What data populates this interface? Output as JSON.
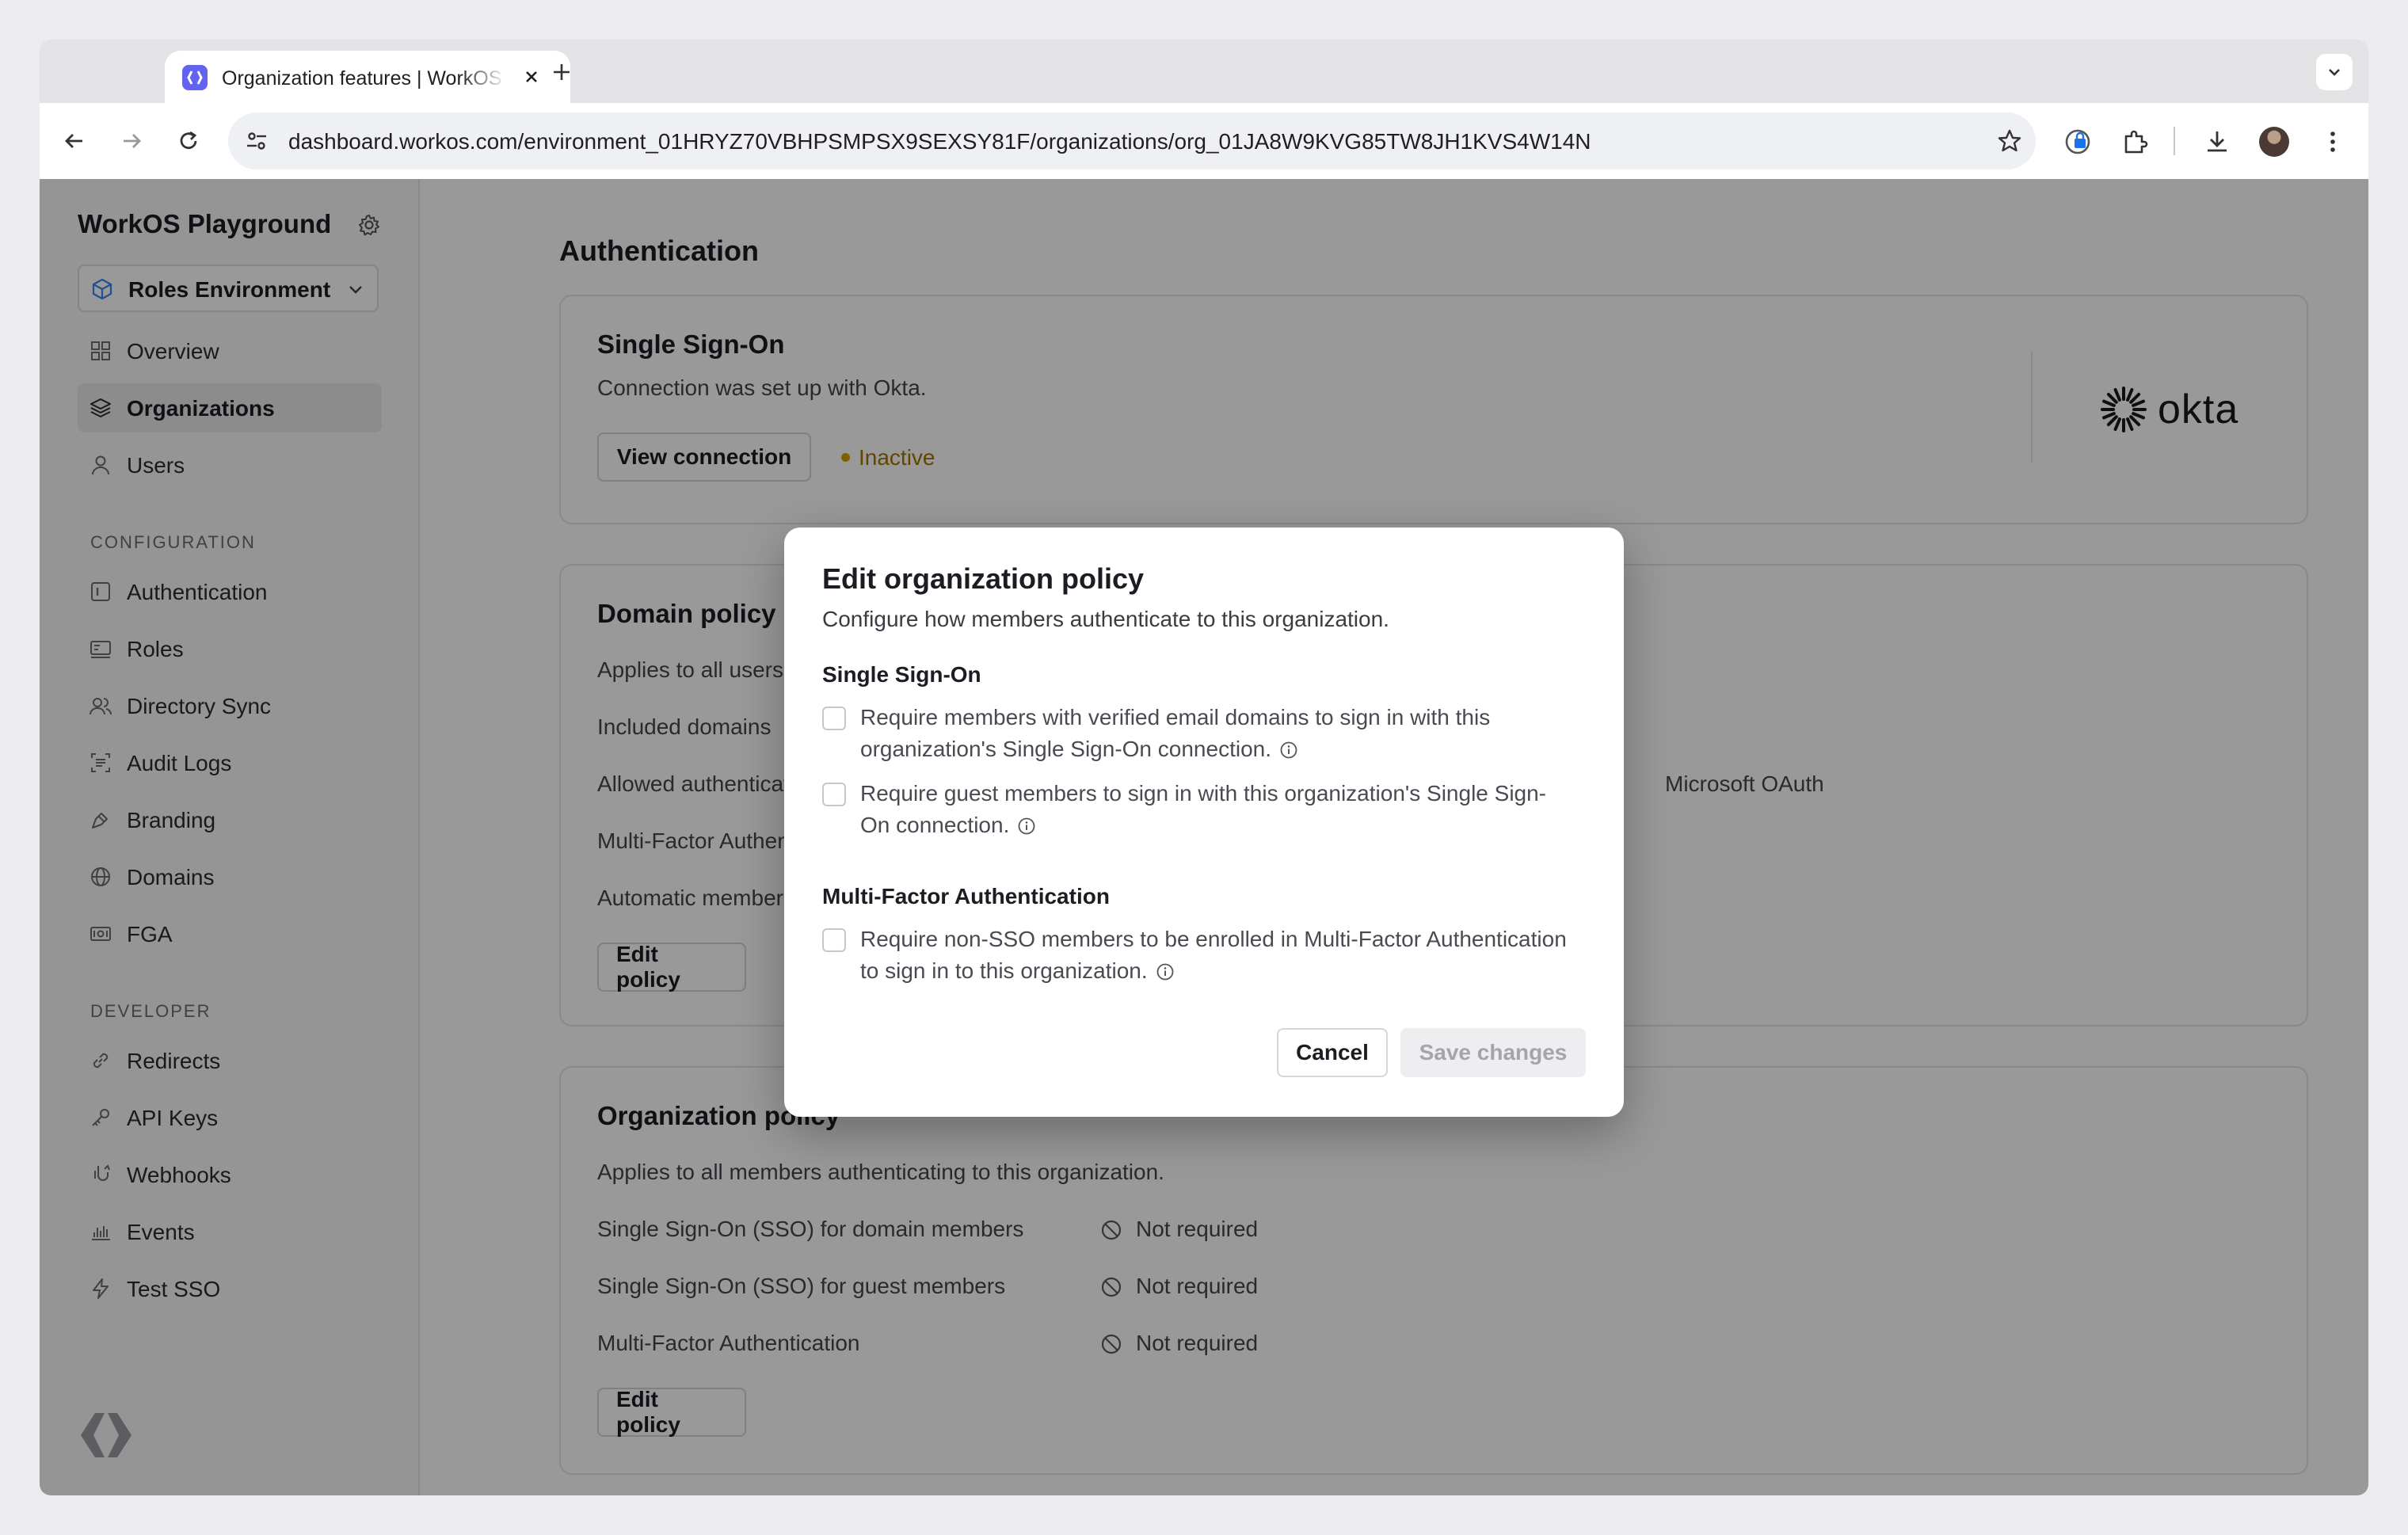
{
  "browser": {
    "tab_title": "Organization features | WorkOS",
    "url_host": "dashboard.workos.com",
    "url_path": "/environment_01HRYZ70VBHPSMPSX9SEXSY81F/organizations/org_01JA8W9KVG85TW8JH1KVS4W14N"
  },
  "sidebar": {
    "workspace": "WorkOS Playground",
    "environment": "Roles Environment",
    "main_items": [
      {
        "label": "Overview",
        "icon": "grid-icon"
      },
      {
        "label": "Organizations",
        "icon": "layers-icon",
        "active": true
      },
      {
        "label": "Users",
        "icon": "user-icon"
      }
    ],
    "config_heading": "CONFIGURATION",
    "config_items": [
      {
        "label": "Authentication",
        "icon": "auth-icon"
      },
      {
        "label": "Roles",
        "icon": "roles-icon"
      },
      {
        "label": "Directory Sync",
        "icon": "directory-icon"
      },
      {
        "label": "Audit Logs",
        "icon": "audit-icon"
      },
      {
        "label": "Branding",
        "icon": "brush-icon"
      },
      {
        "label": "Domains",
        "icon": "globe-icon"
      },
      {
        "label": "FGA",
        "icon": "fga-icon"
      }
    ],
    "developer_heading": "DEVELOPER",
    "developer_items": [
      {
        "label": "Redirects",
        "icon": "link-icon"
      },
      {
        "label": "API Keys",
        "icon": "key-icon"
      },
      {
        "label": "Webhooks",
        "icon": "webhook-icon"
      },
      {
        "label": "Events",
        "icon": "events-icon"
      },
      {
        "label": "Test SSO",
        "icon": "bolt-icon"
      }
    ]
  },
  "main": {
    "page_title": "Authentication",
    "sso_card": {
      "title": "Single Sign-On",
      "description": "Connection was set up with Okta.",
      "button": "View connection",
      "status": "Inactive",
      "provider": "okta"
    },
    "domain_card": {
      "title": "Domain policy",
      "description": "Applies to all users wit",
      "rows": [
        "Included domains",
        "Allowed authenticatio",
        "Multi-Factor Authentic",
        "Automatic membershi"
      ],
      "partial_value": "Microsoft OAuth",
      "button": "Edit policy"
    },
    "org_card": {
      "title": "Organization policy",
      "description": "Applies to all members authenticating to this organization.",
      "rows": [
        {
          "label": "Single Sign-On (SSO) for domain members",
          "value": "Not required"
        },
        {
          "label": "Single Sign-On (SSO) for guest members",
          "value": "Not required"
        },
        {
          "label": "Multi-Factor Authentication",
          "value": "Not required"
        }
      ],
      "button": "Edit policy"
    }
  },
  "modal": {
    "title": "Edit organization policy",
    "subtitle": "Configure how members authenticate to this organization.",
    "sso_heading": "Single Sign-On",
    "sso_option_1": "Require members with verified email domains to sign in with this organization's Single Sign-On connection.",
    "sso_option_2": "Require guest members to sign in with this organization's Single Sign-On connection.",
    "mfa_heading": "Multi-Factor Authentication",
    "mfa_option": "Require non-SSO members to be enrolled in Multi-Factor Authentication to sign in to this organization.",
    "cancel": "Cancel",
    "save": "Save changes"
  }
}
